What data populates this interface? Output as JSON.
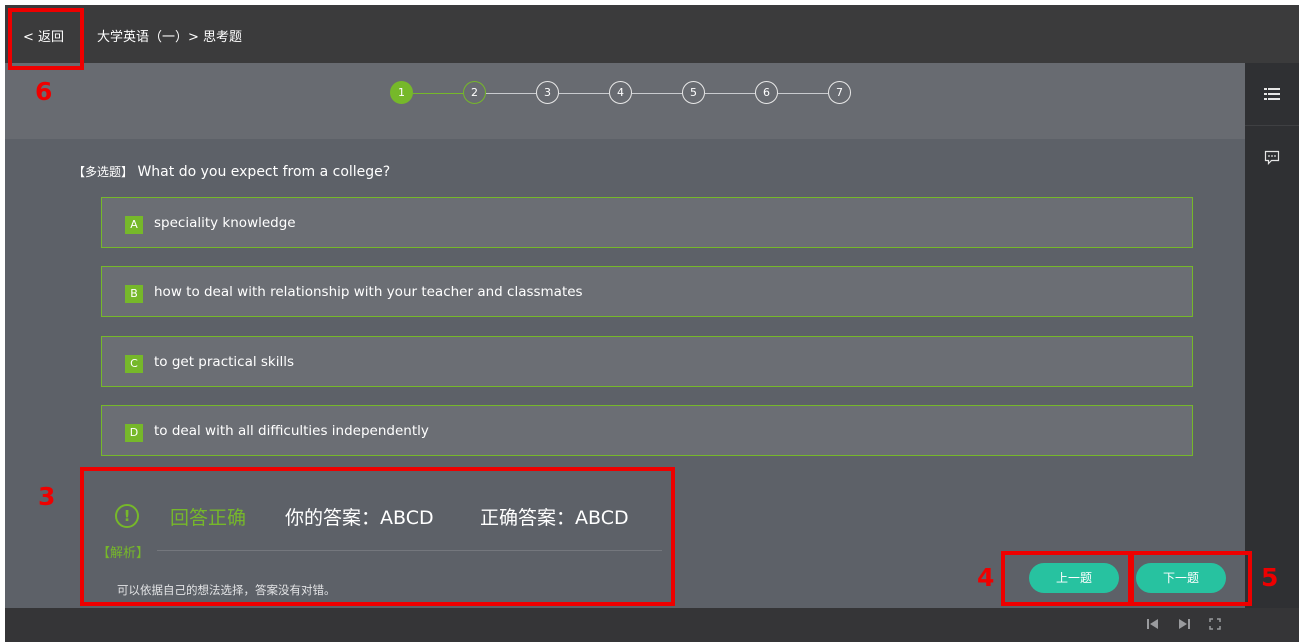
{
  "topbar": {
    "back_label": "< 返回",
    "breadcrumb": "大学英语（一）> 思考题"
  },
  "stepper": {
    "steps": [
      "1",
      "2",
      "3",
      "4",
      "5",
      "6",
      "7"
    ],
    "active": "1"
  },
  "question": {
    "type_label": "【多选题】",
    "text": "What do you expect from a college?"
  },
  "options": [
    {
      "letter": "A",
      "text": "speciality knowledge"
    },
    {
      "letter": "B",
      "text": "how to deal with relationship with your teacher and classmates"
    },
    {
      "letter": "C",
      "text": "to get practical skills"
    },
    {
      "letter": "D",
      "text": "to deal with all difficulties independently"
    }
  ],
  "result": {
    "icon_glyph": "!",
    "status": "回答正确",
    "your_answer": "你的答案：ABCD",
    "correct_answer": "正确答案：ABCD",
    "analysis_label": "【解析】",
    "analysis_text": "可以依据自己的想法选择，答案没有对错。"
  },
  "nav": {
    "prev_label": "上一题",
    "next_label": "下一题"
  },
  "annotations": {
    "n3": "3",
    "n4": "4",
    "n5": "5",
    "n6": "6"
  },
  "icons": {
    "rail_top": "list-icon",
    "rail_second": "comment-icon",
    "bottom": [
      "skip-back-icon",
      "skip-forward-icon",
      "fullscreen-icon"
    ]
  },
  "colors": {
    "accent_green": "#76b82a",
    "button_teal": "#27c2a0",
    "annotation_red": "#ee0000"
  }
}
